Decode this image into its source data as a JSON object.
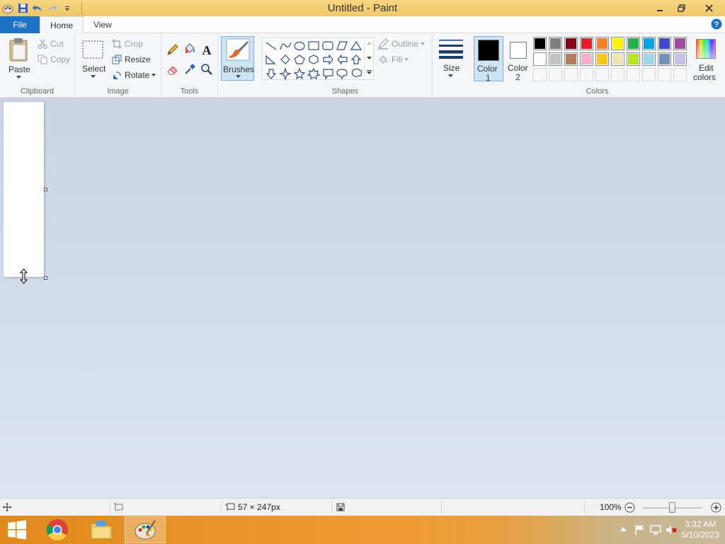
{
  "window": {
    "title": "Untitled - Paint"
  },
  "tabs": {
    "file": "File",
    "home": "Home",
    "view": "View"
  },
  "clipboard": {
    "paste": "Paste",
    "cut": "Cut",
    "copy": "Copy",
    "label": "Clipboard"
  },
  "image": {
    "select": "Select",
    "crop": "Crop",
    "resize": "Resize",
    "rotate": "Rotate",
    "label": "Image"
  },
  "tools": {
    "label": "Tools"
  },
  "brushes": {
    "label": "Brushes"
  },
  "shapes": {
    "outline": "Outline",
    "fill": "Fill",
    "label": "Shapes"
  },
  "size": {
    "label": "Size"
  },
  "colors": {
    "color1": "Color",
    "color1_num": "1",
    "color2": "Color",
    "color2_num": "2",
    "edit_line1": "Edit",
    "edit_line2": "colors",
    "label": "Colors",
    "color1_value": "#000000",
    "color2_value": "#ffffff",
    "palette_row1": [
      "#000000",
      "#7f7f7f",
      "#880015",
      "#ed1c24",
      "#ff7f27",
      "#fff200",
      "#22b14c",
      "#00a2e8",
      "#3f48cc",
      "#a349a4"
    ],
    "palette_row2": [
      "#ffffff",
      "#c3c3c3",
      "#b97a57",
      "#ffaec9",
      "#ffc90e",
      "#efe4b0",
      "#b5e61d",
      "#99d9ea",
      "#7092be",
      "#c8bfe7"
    ]
  },
  "status": {
    "canvas_size": "57 × 247px",
    "zoom": "100%",
    "zoom_level": 0.5
  },
  "taskbar": {
    "time": "3:32 AM",
    "date": "5/10/2023"
  }
}
